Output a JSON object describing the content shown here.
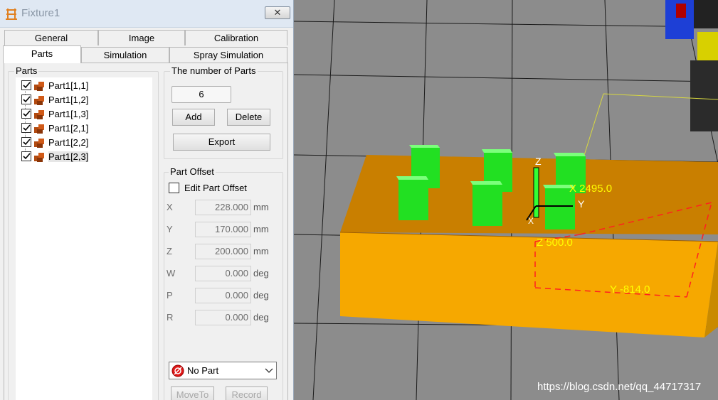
{
  "window": {
    "title": "Fixture1",
    "close_label": "✕"
  },
  "tabs_row1": [
    "General",
    "Image",
    "Calibration"
  ],
  "tabs_row2": [
    "Parts",
    "Simulation",
    "Spray Simulation"
  ],
  "active_tab": "Parts",
  "parts_panel": {
    "label": "Parts",
    "items": [
      {
        "label": "Part1[1,1]",
        "checked": true
      },
      {
        "label": "Part1[1,2]",
        "checked": true
      },
      {
        "label": "Part1[1,3]",
        "checked": true
      },
      {
        "label": "Part1[2,1]",
        "checked": true
      },
      {
        "label": "Part1[2,2]",
        "checked": true
      },
      {
        "label": "Part1[2,3]",
        "checked": true,
        "selected": true
      }
    ]
  },
  "number_of_parts": {
    "label": "The number of Parts",
    "value": "6",
    "add_label": "Add",
    "delete_label": "Delete",
    "export_label": "Export"
  },
  "part_offset": {
    "label": "Part Offset",
    "edit_label": "Edit Part Offset",
    "rows": [
      {
        "axis": "X",
        "value": "228.000",
        "unit": "mm"
      },
      {
        "axis": "Y",
        "value": "170.000",
        "unit": "mm"
      },
      {
        "axis": "Z",
        "value": "200.000",
        "unit": "mm"
      },
      {
        "axis": "W",
        "value": "0.000",
        "unit": "deg"
      },
      {
        "axis": "P",
        "value": "0.000",
        "unit": "deg"
      },
      {
        "axis": "R",
        "value": "0.000",
        "unit": "deg"
      }
    ]
  },
  "part_select": {
    "value": "No Part"
  },
  "bottom_buttons": {
    "moveto_label": "MoveTo",
    "record_label": "Record"
  },
  "viewport": {
    "label_x": "X 2495.0",
    "label_z": "Z 500.0",
    "label_y": "Y -814.0",
    "axis_x": "X",
    "axis_y": "Y",
    "axis_z": "Z",
    "colors": {
      "fixture": "#f6a800",
      "part": "#2ee02e",
      "floor": "#8c8c8c",
      "label": "#ffff00",
      "dash": "#ff2020"
    }
  },
  "watermark": "https://blog.csdn.net/qq_44717317"
}
